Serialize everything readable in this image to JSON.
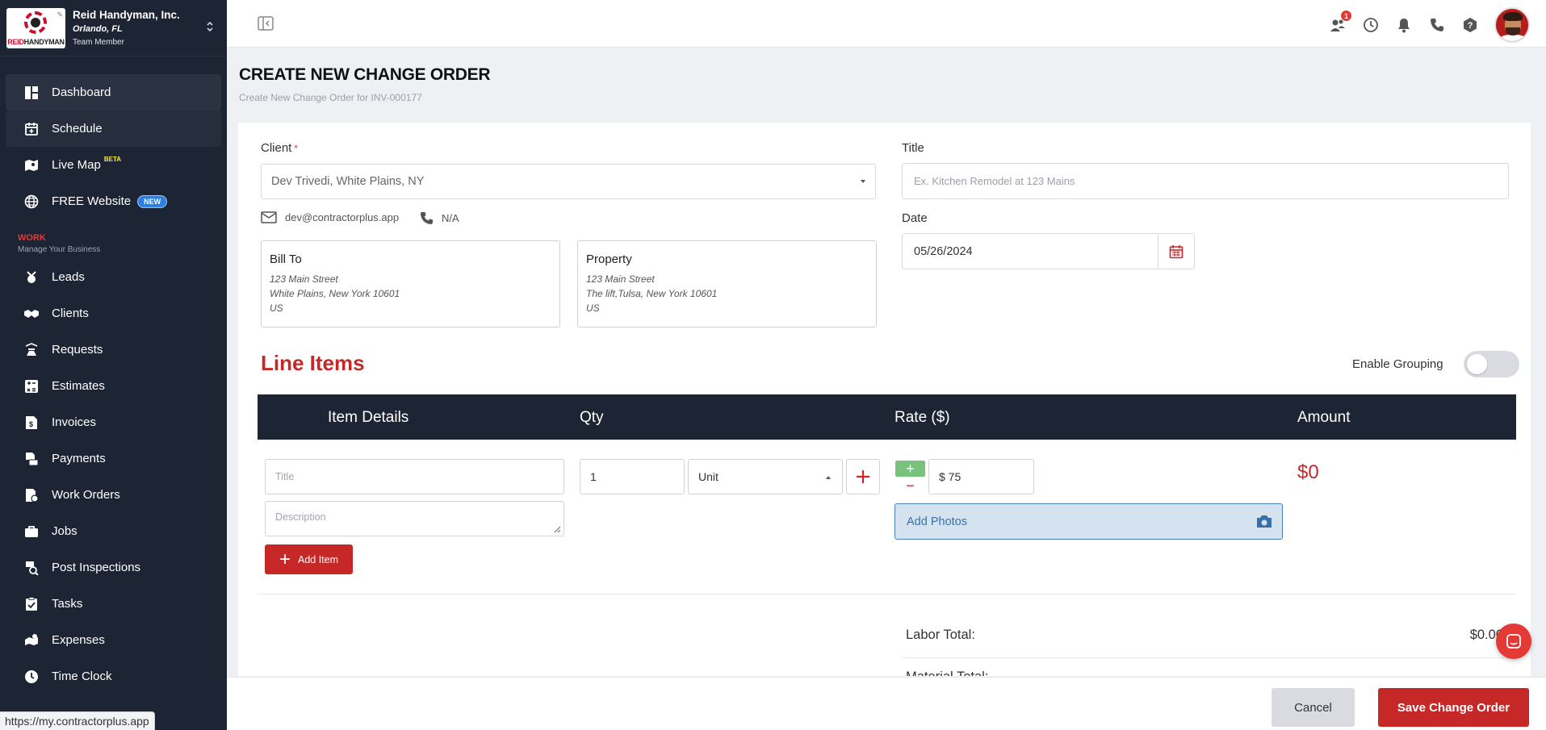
{
  "company": {
    "name": "Reid Handyman, Inc.",
    "location": "Orlando, FL",
    "role": "Team Member",
    "logo_text_red": "REID",
    "logo_text_dark": "HANDYMAN"
  },
  "sidebar": {
    "items_top": [
      {
        "label": "Dashboard",
        "icon": "dashboard-icon"
      },
      {
        "label": "Schedule",
        "icon": "calendar-icon"
      },
      {
        "label": "Live Map",
        "icon": "map-icon",
        "badge": "BETA"
      },
      {
        "label": "FREE Website",
        "icon": "globe-icon",
        "badge": "NEW"
      }
    ],
    "section": {
      "title": "WORK",
      "subtitle": "Manage Your Business"
    },
    "items_work": [
      {
        "label": "Leads",
        "icon": "leads-icon"
      },
      {
        "label": "Clients",
        "icon": "handshake-icon"
      },
      {
        "label": "Requests",
        "icon": "requests-icon"
      },
      {
        "label": "Estimates",
        "icon": "calculator-icon"
      },
      {
        "label": "Invoices",
        "icon": "invoice-icon"
      },
      {
        "label": "Payments",
        "icon": "payments-icon"
      },
      {
        "label": "Work Orders",
        "icon": "work-orders-icon"
      },
      {
        "label": "Jobs",
        "icon": "briefcase-icon"
      },
      {
        "label": "Post Inspections",
        "icon": "inspection-icon"
      },
      {
        "label": "Tasks",
        "icon": "tasks-icon"
      },
      {
        "label": "Expenses",
        "icon": "expenses-icon"
      },
      {
        "label": "Time Clock",
        "icon": "clock-icon"
      }
    ]
  },
  "topbar": {
    "notification_count": "1"
  },
  "status_url": "https://my.contractorplus.app",
  "page": {
    "title": "CREATE NEW CHANGE ORDER",
    "subtitle": "Create New Change Order for INV-000177"
  },
  "form": {
    "client_label": "Client",
    "client_required": "*",
    "client_value": "Dev Trivedi, White Plains, NY",
    "email": "dev@contractorplus.app",
    "phone": "N/A",
    "bill_to": {
      "title": "Bill To",
      "lines": [
        "123 Main Street",
        "White Plains, New York 10601",
        "US"
      ]
    },
    "property": {
      "title": "Property",
      "lines": [
        "123 Main Street",
        "The lift,Tulsa, New York 10601",
        "US"
      ]
    },
    "title_label": "Title",
    "title_placeholder": "Ex. Kitchen Remodel at 123 Mains",
    "date_label": "Date",
    "date_value": "05/26/2024"
  },
  "line_items": {
    "heading": "Line Items",
    "grouping_label": "Enable Grouping",
    "grouping_enabled": false,
    "columns": [
      "Item Details",
      "Qty",
      "Rate ($)",
      "Amount"
    ],
    "item": {
      "title_placeholder": "Title",
      "description_placeholder": "Description",
      "qty": "1",
      "unit": "Unit",
      "rate": "$ 75",
      "add_photos": "Add Photos",
      "amount": "$0"
    },
    "add_item_label": "Add Item"
  },
  "totals": {
    "labor_label": "Labor Total:",
    "labor_value": "$0.00",
    "material_label": "Material Total:"
  },
  "actions": {
    "cancel": "Cancel",
    "save": "Save Change Order"
  },
  "colors": {
    "sidebar": "#1d2433",
    "accent": "#c62828",
    "background": "#eef0f4"
  }
}
